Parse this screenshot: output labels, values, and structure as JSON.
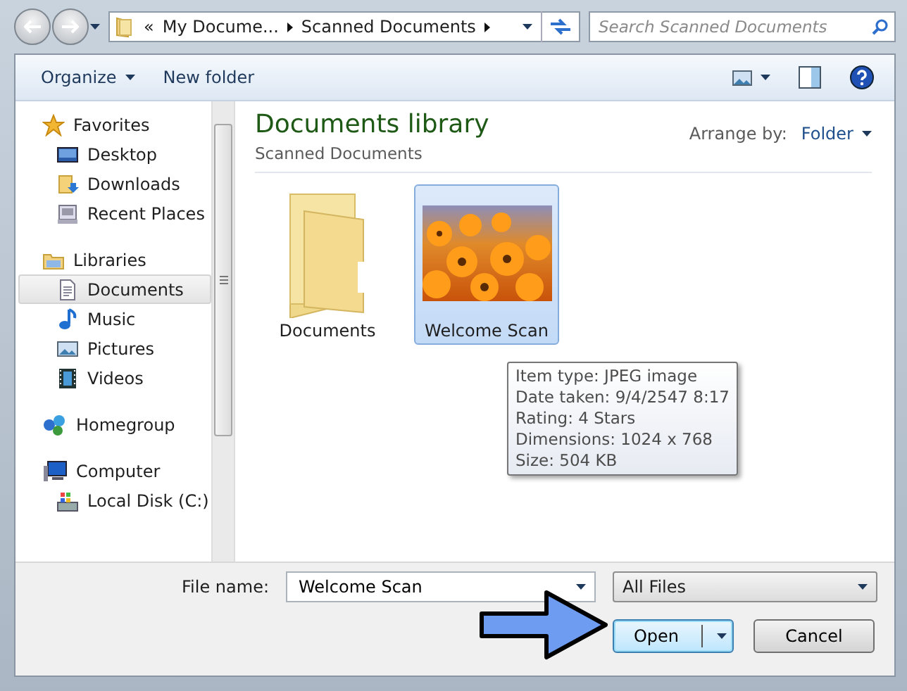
{
  "address": {
    "chevron": "«",
    "segments": [
      "My Docume...",
      "Scanned Documents"
    ]
  },
  "search": {
    "placeholder": "Search Scanned Documents"
  },
  "toolbar": {
    "organize": "Organize",
    "new_folder": "New folder"
  },
  "navigation": [
    {
      "label": "Favorites",
      "kind": "star",
      "selected": false,
      "children": [
        {
          "label": "Desktop",
          "kind": "desktop",
          "selected": false
        },
        {
          "label": "Downloads",
          "kind": "downloads",
          "selected": false
        },
        {
          "label": "Recent Places",
          "kind": "recent",
          "selected": false
        }
      ]
    },
    {
      "label": "Libraries",
      "kind": "library",
      "selected": false,
      "children": [
        {
          "label": "Documents",
          "kind": "document",
          "selected": true
        },
        {
          "label": "Music",
          "kind": "music",
          "selected": false
        },
        {
          "label": "Pictures",
          "kind": "pictures",
          "selected": false
        },
        {
          "label": "Videos",
          "kind": "videos",
          "selected": false
        }
      ]
    },
    {
      "label": "Homegroup",
      "kind": "homegroup",
      "selected": false
    },
    {
      "label": "Computer",
      "kind": "computer",
      "selected": false,
      "children": [
        {
          "label": "Local Disk (C:)",
          "kind": "disk",
          "selected": false
        }
      ]
    }
  ],
  "library": {
    "title": "Documents library",
    "subtitle": "Scanned Documents",
    "arrange_label": "Arrange by:",
    "arrange_value": "Folder"
  },
  "items": [
    {
      "name": "Documents",
      "kind": "folder",
      "selected": false
    },
    {
      "name": "Welcome Scan",
      "kind": "photo",
      "selected": true
    }
  ],
  "tooltip": [
    "Item type: JPEG image",
    "Date taken: 9/4/2547 8:17",
    "Rating: 4 Stars",
    "Dimensions: 1024 x 768",
    "Size: 504 KB"
  ],
  "bottom": {
    "file_name_label": "File name:",
    "file_name": "Welcome Scan",
    "filter": "All Files",
    "buttons": [
      {
        "label": "Open",
        "kind": "split",
        "selected": true
      },
      {
        "label": "Cancel",
        "kind": "plain",
        "selected": false
      }
    ]
  }
}
